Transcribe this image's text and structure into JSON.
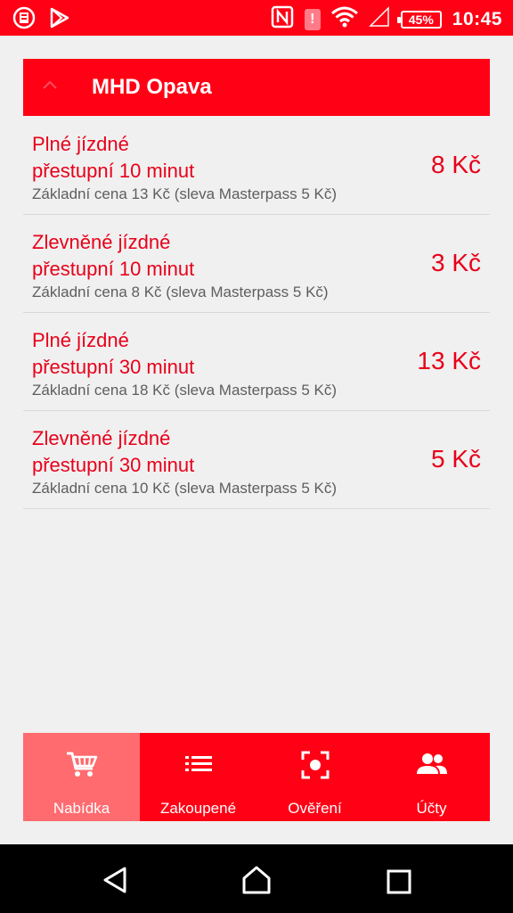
{
  "status_bar": {
    "battery": "45%",
    "time": "10:45",
    "alert_glyph": "!"
  },
  "header": {
    "title": "MHD Opava"
  },
  "tickets": [
    {
      "title_line1": "Plné jízdné",
      "title_line2": "přestupní 10 minut",
      "subtitle": "Základní cena 13 Kč (sleva Masterpass 5 Kč)",
      "price": "8 Kč"
    },
    {
      "title_line1": "Zlevněné jízdné",
      "title_line2": "přestupní 10 minut",
      "subtitle": "Základní cena 8 Kč (sleva Masterpass 5 Kč)",
      "price": "3 Kč"
    },
    {
      "title_line1": "Plné jízdné",
      "title_line2": "přestupní 30 minut",
      "subtitle": "Základní cena 18 Kč (sleva Masterpass 5 Kč)",
      "price": "13 Kč"
    },
    {
      "title_line1": "Zlevněné jízdné",
      "title_line2": "přestupní 30 minut",
      "subtitle": "Základní cena 10 Kč (sleva Masterpass 5 Kč)",
      "price": "5 Kč"
    }
  ],
  "bottom_nav": {
    "tabs": [
      {
        "label": "Nabídka",
        "icon": "cart-icon",
        "active": true
      },
      {
        "label": "Zakoupené",
        "icon": "list-icon",
        "active": false
      },
      {
        "label": "Ověření",
        "icon": "scan-icon",
        "active": false
      },
      {
        "label": "Účty",
        "icon": "people-icon",
        "active": false
      }
    ]
  },
  "colors": {
    "brand_red": "#ff0015",
    "text_red": "#e8001a",
    "active_tab": "#ff6b6f"
  }
}
